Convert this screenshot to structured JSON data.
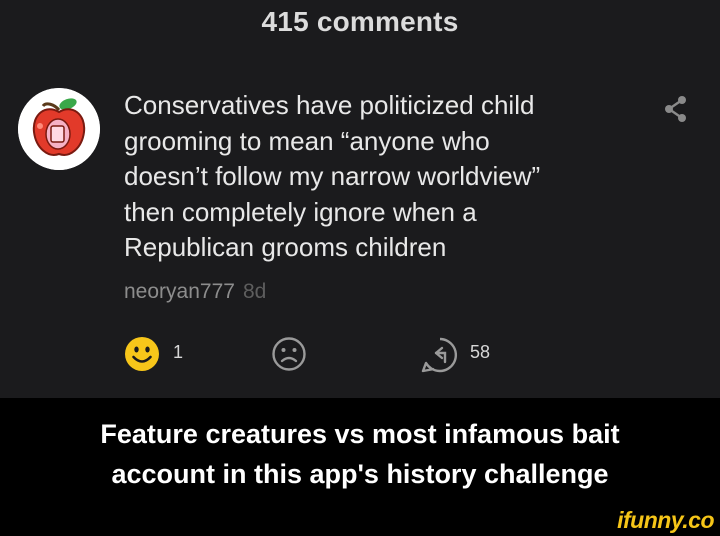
{
  "header": {
    "title": "415 comments"
  },
  "comment": {
    "text": "Conservatives have politicized child\ngrooming to mean “anyone who\ndoesn’t follow my narrow worldview”\nthen completely ignore when a\nRepublican grooms children",
    "username": "neoryan777",
    "age": "8d",
    "avatar_icon": "apple-avatar",
    "share_icon": "share-icon",
    "actions": {
      "smile_icon": "smile-icon",
      "smile_count": "1",
      "frown_icon": "frown-icon",
      "reply_icon": "reply-icon",
      "reply_count": "58"
    }
  },
  "caption": {
    "text": "Feature creatures vs most infamous bait\naccount in this app's history challenge"
  },
  "watermark": {
    "text": "ifunny.co"
  },
  "colors": {
    "screen_bg": "#1b1b1d",
    "caption_bg": "#000000",
    "smile_yellow": "#f7c61a",
    "watermark": "#f5c518"
  }
}
